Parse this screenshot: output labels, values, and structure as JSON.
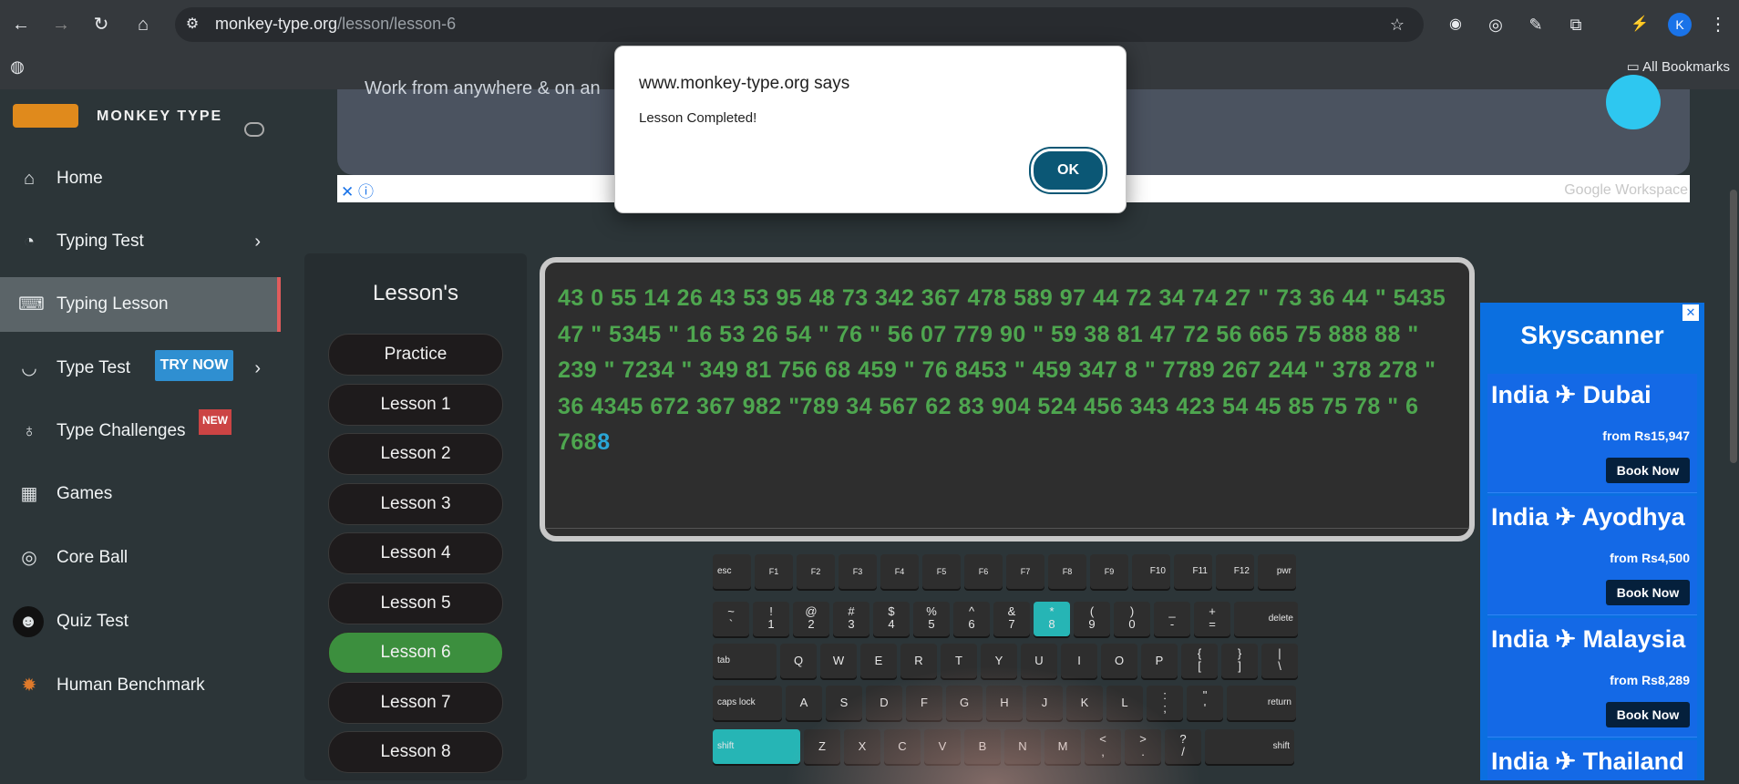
{
  "browser": {
    "url_host": "monkey-type.org",
    "url_path": "/lesson/lesson-6",
    "bookmarks_label": "All Bookmarks",
    "avatar_initial": "K"
  },
  "sidebar": {
    "brand": "MONKEY TYPE",
    "items": [
      {
        "label": "Home",
        "icon": "home-icon"
      },
      {
        "label": "Typing Test",
        "icon": "github-icon"
      },
      {
        "label": "Typing Lesson",
        "icon": "keyboard-icon"
      },
      {
        "label": "Type Test",
        "icon": "cat-icon"
      },
      {
        "label": "Type Challenges",
        "icon": "ribbon-icon"
      },
      {
        "label": "Games",
        "icon": "grid-icon"
      },
      {
        "label": "Core Ball",
        "icon": "target-icon"
      },
      {
        "label": "Quiz Test",
        "icon": "brain-icon"
      },
      {
        "label": "Human Benchmark",
        "icon": "explosion-icon"
      }
    ],
    "try_now_badge": "TRY NOW",
    "new_badge": "NEW"
  },
  "ad_top": {
    "text": "Work from anywhere & on an",
    "brand": "Google Workspace"
  },
  "lessons": {
    "title": "Lesson's",
    "items": [
      "Practice",
      "Lesson 1",
      "Lesson 2",
      "Lesson 3",
      "Lesson 4",
      "Lesson 5",
      "Lesson 6",
      "Lesson 7",
      "Lesson 8"
    ],
    "active": "Lesson 6"
  },
  "typing": {
    "text": "43 0 55 14 26 43 53 95 48 73 342 367 478 589 97 44 72 34 74 27 \" 73 36 44 \" 5435 47 \" 5345 \" 16 53 26 54 \" 76 \" 56 07 779 90 \" 59 38 81 47 72 56 665 75 888 88 \" 239 \" 7234 \" 349 81 756 68 459 \" 76 8453 \" 459 347 8 \" 7789 267 244 \" 378 278 \" 36 4345 672 367 982 \"789 34 567 62 83 904 524 456 343 423 54 45 85 75 78 \" 6 768",
    "current_char": "8"
  },
  "keyboard": {
    "row0": [
      "esc",
      "F1",
      "F2",
      "F3",
      "F4",
      "F5",
      "F6",
      "F7",
      "F8",
      "F9",
      "F10",
      "F11",
      "F12",
      "pwr"
    ],
    "row1": [
      "~ `",
      "! 1",
      "@ 2",
      "# 3",
      "$ 4",
      "% 5",
      "^ 6",
      "& 7",
      "* 8",
      "( 9",
      ") 0",
      "_ -",
      "+ =",
      "delete"
    ],
    "row2": [
      "tab",
      "Q",
      "W",
      "E",
      "R",
      "T",
      "Y",
      "U",
      "I",
      "O",
      "P",
      "{ [",
      "} ]",
      "| \\"
    ],
    "row3": [
      "caps lock",
      "A",
      "S",
      "D",
      "F",
      "G",
      "H",
      "J",
      "K",
      "L",
      ": ;",
      "\" '",
      "return"
    ],
    "row4": [
      "shift",
      "Z",
      "X",
      "C",
      "V",
      "B",
      "N",
      "M",
      "< ,",
      "> .",
      "? /",
      "shift"
    ],
    "highlight_color": "#26b5b5"
  },
  "right_ad": {
    "brand": "Skyscanner",
    "cards": [
      {
        "dest": "India ✈ Dubai",
        "from": "from Rs15,947",
        "cta": "Book Now"
      },
      {
        "dest": "India ✈ Ayodhya",
        "from": "from Rs4,500",
        "cta": "Book Now"
      },
      {
        "dest": "India ✈ Malaysia",
        "from": "from Rs8,289",
        "cta": "Book Now"
      },
      {
        "dest": "India ✈ Thailand",
        "from": "",
        "cta": ""
      }
    ]
  },
  "dialog": {
    "title": "www.monkey-type.org says",
    "message": "Lesson Completed!",
    "ok": "OK"
  }
}
